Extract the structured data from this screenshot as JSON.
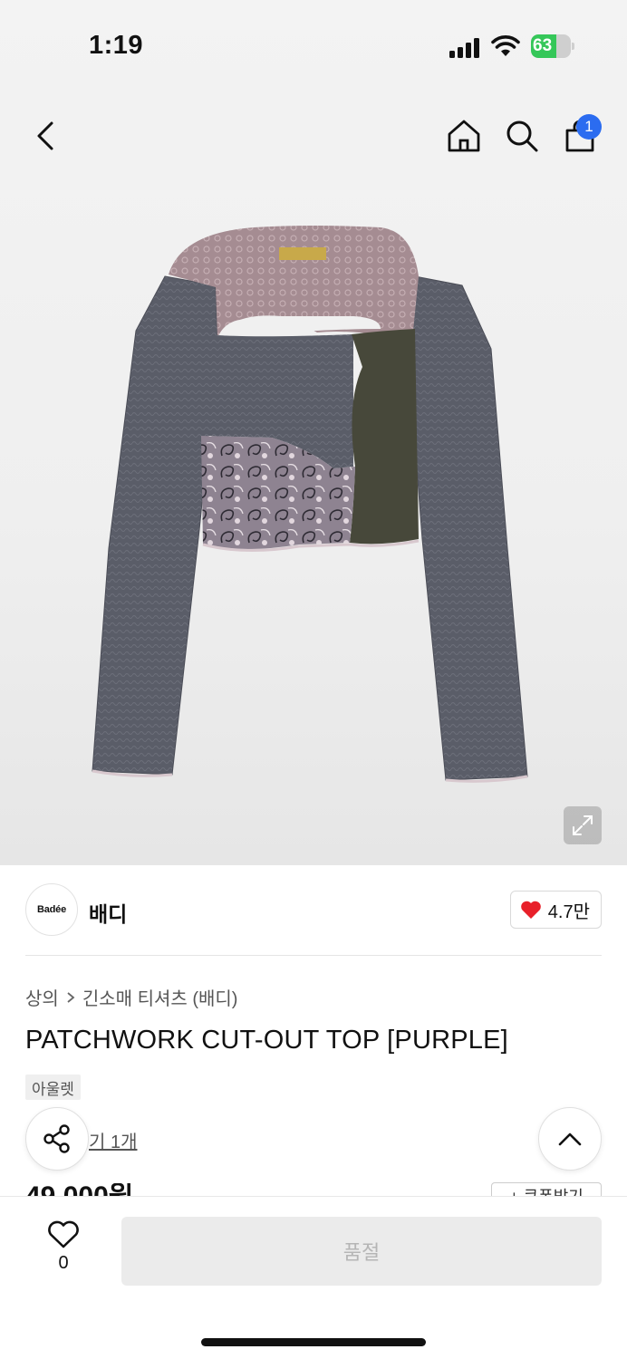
{
  "status_bar": {
    "time": "1:19",
    "battery": "63",
    "battery_level": 0.63
  },
  "nav": {
    "cart_count": "1"
  },
  "brand": {
    "logo_text": "Badée",
    "name": "배디",
    "like_count": "4.7만"
  },
  "breadcrumb": {
    "category": "상의",
    "subcategory": "긴소매 티셔츠 (배디)"
  },
  "product": {
    "title": "PATCHWORK CUT-OUT TOP [PURPLE]",
    "badge": "아울렛",
    "review_link": "기 1개",
    "price_partial": "49,000원",
    "coupon_partial": "+ 쿠폰받기"
  },
  "bottom": {
    "wish_count": "0",
    "soldout_label": "품절"
  },
  "colors": {
    "accent_blue": "#2b6cf0",
    "heart_red": "#e8202a",
    "battery_green": "#35c759"
  }
}
